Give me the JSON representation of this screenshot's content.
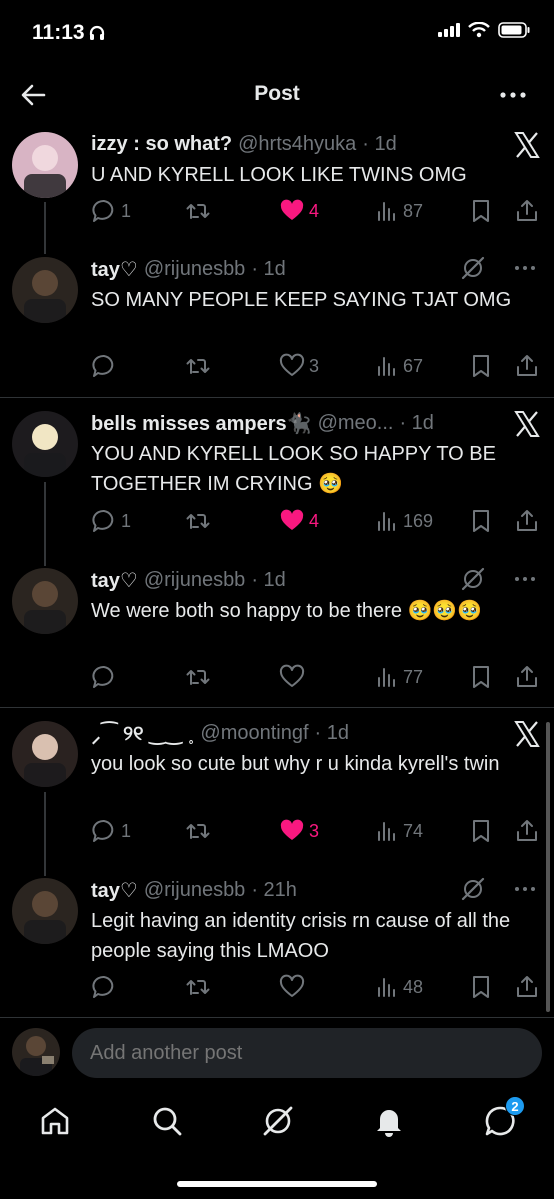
{
  "status": {
    "time": "11:13"
  },
  "header": {
    "title": "Post"
  },
  "posts": [
    {
      "name": "izzy : so what?",
      "handle": "@hrts4hyuka",
      "time": "· 1d",
      "text": "U AND KYRELL LOOK LIKE TWINS OMG",
      "replies": "1",
      "likes": "4",
      "views": "87",
      "liked": true
    },
    {
      "name": "tay♡",
      "handle": "@rijunesbb",
      "time": "· 1d",
      "text": "SO MANY PEOPLE KEEP SAYING TJAT OMG",
      "replies": "",
      "likes": "3",
      "views": "67",
      "liked": false
    },
    {
      "name": "bells misses ampers🐈‍⬛",
      "handle": "@meo...",
      "time": "· 1d",
      "text": "YOU AND KYRELL LOOK SO HAPPY TO BE TOGETHER IM CRYING 🥹",
      "replies": "1",
      "likes": "4",
      "views": "169",
      "liked": true
    },
    {
      "name": "tay♡",
      "handle": "@rijunesbb",
      "time": "· 1d",
      "text": "We were both so happy to be there 🥹🥹🥹",
      "replies": "",
      "likes": "",
      "views": "77",
      "liked": false
    },
    {
      "name": "⸝⁀ ୨୧ ‿‿ ˳",
      "handle": "@moontingf",
      "time": "· 1d",
      "text": "you look so cute but why r u kinda kyrell's twin",
      "replies": "1",
      "likes": "3",
      "views": "74",
      "liked": true
    },
    {
      "name": "tay♡",
      "handle": "@rijunesbb",
      "time": "· 21h",
      "text": "Legit having an identity crisis rn cause of all the people saying this LMAOO",
      "replies": "",
      "likes": "",
      "views": "48",
      "liked": false
    }
  ],
  "compose": {
    "placeholder": "Add another post"
  },
  "nav": {
    "messages_badge": "2"
  },
  "colors": {
    "accent": "#1d9bf0",
    "like": "#f91880",
    "muted": "#71767b",
    "text": "#e7e9ea"
  },
  "icons": [
    "back-arrow-icon",
    "more-icon",
    "x-logo-icon",
    "grok-icon",
    "reply-icon",
    "repost-icon",
    "heart-icon",
    "views-icon",
    "bookmark-icon",
    "share-icon",
    "home-icon",
    "search-icon",
    "notifications-icon",
    "messages-icon"
  ]
}
